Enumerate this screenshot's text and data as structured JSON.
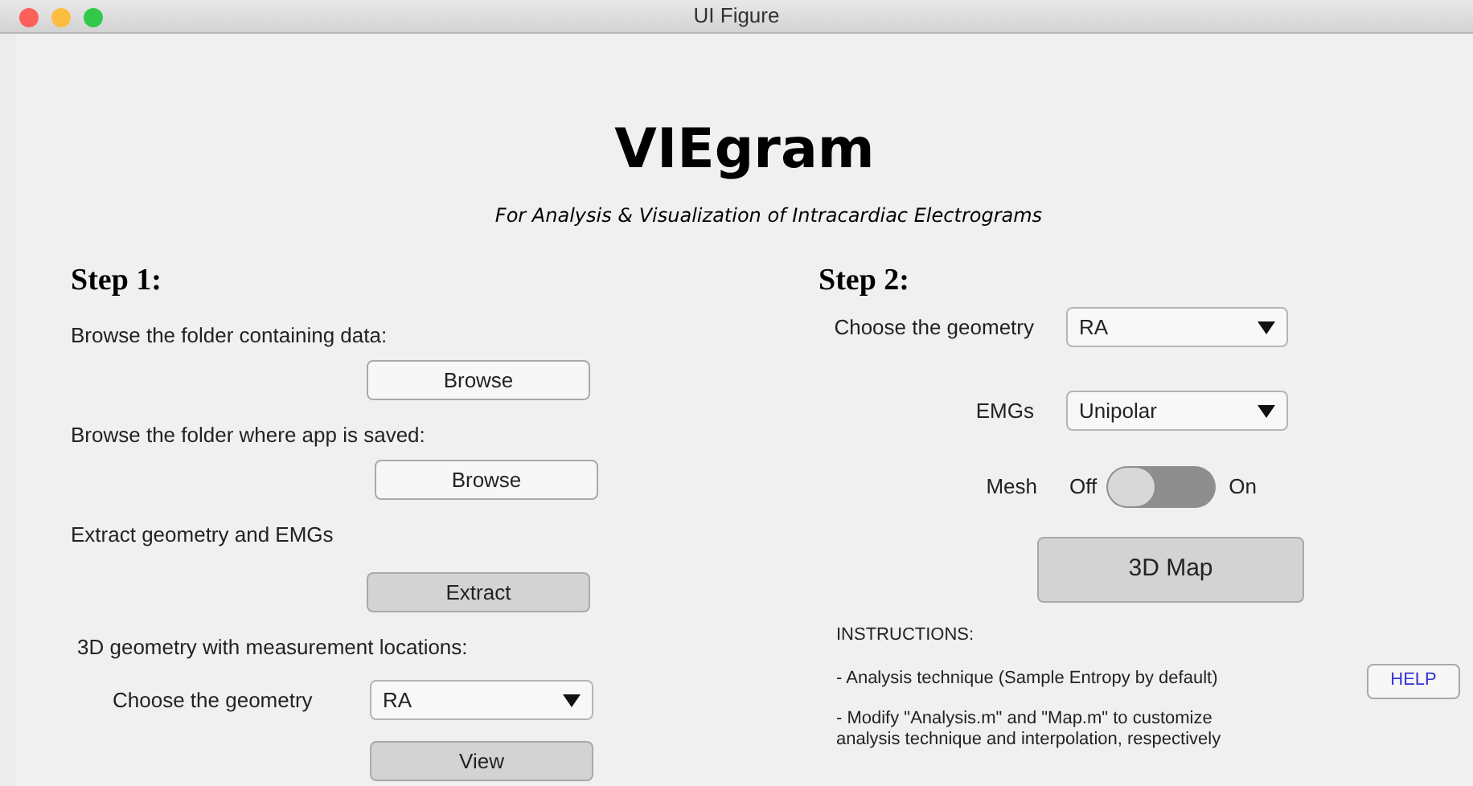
{
  "window": {
    "title": "UI Figure"
  },
  "app_title": "VIEgram",
  "subtitle": "For Analysis & Visualization of Intracardiac Electrograms",
  "step1": {
    "heading": "Step 1:",
    "items": [
      {
        "kind": "label",
        "text": "Browse the folder containing data:"
      },
      {
        "kind": "button",
        "text": "Browse",
        "shaded": false
      },
      {
        "kind": "label",
        "text": "Browse the folder where app is saved:"
      },
      {
        "kind": "button",
        "text": "Browse",
        "shaded": false
      },
      {
        "kind": "label",
        "text": "Extract geometry and EMGs"
      },
      {
        "kind": "button",
        "text": "Extract",
        "shaded": true
      },
      {
        "kind": "label",
        "text": "3D geometry with measurement locations:"
      },
      {
        "kind": "dropdown",
        "label": "Choose the geometry",
        "value": "RA"
      },
      {
        "kind": "button",
        "text": "View",
        "shaded": true
      }
    ]
  },
  "step2": {
    "heading": "Step 2:",
    "geometry": {
      "label": "Choose the geometry",
      "value": "RA"
    },
    "emgs": {
      "label": "EMGs",
      "value": "Unipolar"
    },
    "mesh": {
      "label": "Mesh",
      "off_label": "Off",
      "on_label": "On",
      "on": false
    },
    "map_button": "3D Map",
    "instructions_heading": "INSTRUCTIONS:",
    "instructions": [
      "- Analysis technique (Sample Entropy by default)",
      "- Modify \"Analysis.m\" and \"Map.m\" to customize analysis technique and interpolation, respectively"
    ],
    "help_button": "HELP"
  }
}
